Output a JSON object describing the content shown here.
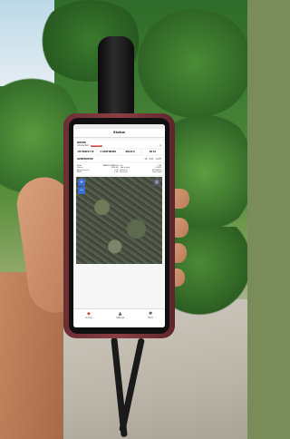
{
  "screen": {
    "title": "Status",
    "rover": {
      "label": "ROVER",
      "connection_status": "Connected",
      "badge": "Disconnect"
    },
    "metrics": [
      "LTE RINEX FIX",
      "5 CONFIRMED",
      "SBCA(3)",
      "88 Pa"
    ],
    "generator": {
      "label": "GENERATOR",
      "values": [
        "18",
        "2.01",
        "1.075"
      ]
    },
    "info_left": [
      "Mode",
      "Datum",
      "Base Distance",
      "PDOP"
    ],
    "info_mid": [
      "TRANSFORMATION",
      "WGS 84",
      "0.09",
      "1.45"
    ],
    "info_right": [
      "Hei",
      "Tool Height",
      "Antenna",
      "Receiver"
    ],
    "info_far": [
      "1.40",
      "1.0000",
      "HT96B0D6",
      "Connected"
    ],
    "tabs": [
      {
        "label": "Survey",
        "icon": "survey-icon",
        "glyph": "◆"
      },
      {
        "label": "Settings",
        "icon": "settings-icon",
        "glyph": "▲"
      },
      {
        "label": "More",
        "icon": "more-icon",
        "glyph": "✱"
      }
    ],
    "map_controls": {
      "zoom_in": "+",
      "zoom_out": "−",
      "locate": "◎"
    }
  },
  "colors": {
    "accent": "#d64545",
    "phone_case": "#7a363c"
  }
}
